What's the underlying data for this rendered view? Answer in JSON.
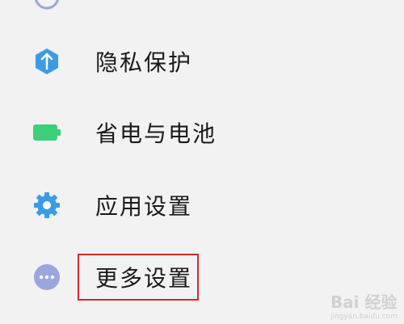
{
  "settings_list": {
    "items": [
      {
        "label": "隐私保护",
        "icon": "privacy-shield-icon",
        "color": "#3b9be6"
      },
      {
        "label": "省电与电池",
        "icon": "battery-icon",
        "color": "#3ecf7a"
      },
      {
        "label": "应用设置",
        "icon": "gear-icon",
        "color": "#3b9be6"
      },
      {
        "label": "更多设置",
        "icon": "more-dots-icon",
        "color": "#9aa6de"
      }
    ],
    "highlighted": "更多设置",
    "highlight_color": "#d02a2a"
  },
  "watermark": {
    "text": "Bai 经验",
    "sub": "jingyan.baidu.com"
  }
}
